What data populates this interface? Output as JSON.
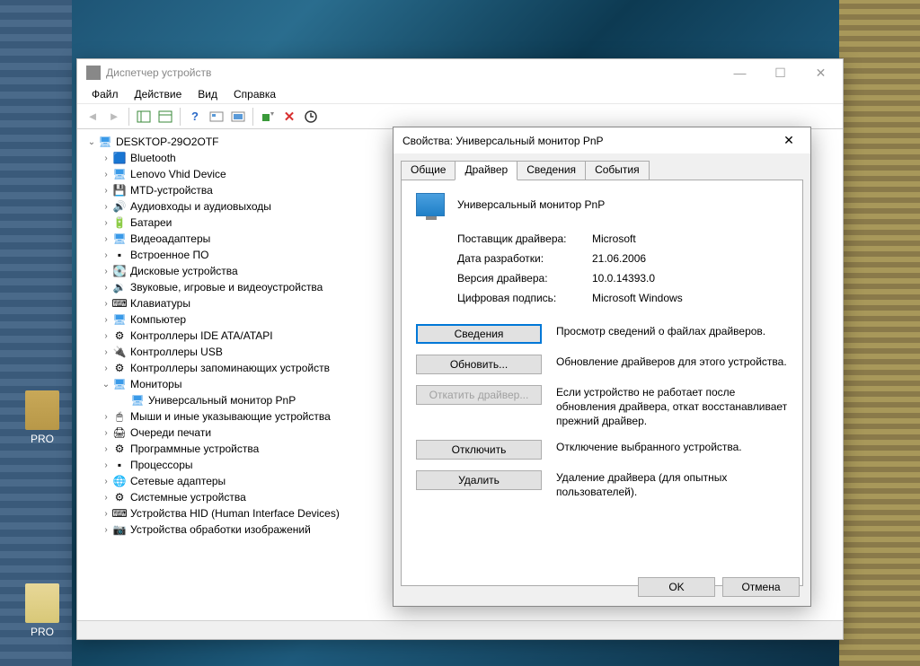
{
  "desktop": {
    "label1": "PRO",
    "label2": "PRO"
  },
  "dm": {
    "title": "Диспетчер устройств",
    "menu": [
      "Файл",
      "Действие",
      "Вид",
      "Справка"
    ],
    "root": "DESKTOP-29O2OTF",
    "nodes": [
      {
        "label": "Bluetooth",
        "icon": "bt"
      },
      {
        "label": "Lenovo Vhid Device",
        "icon": "dev"
      },
      {
        "label": "MTD-устройства",
        "icon": "mtd"
      },
      {
        "label": "Аудиовходы и аудиовыходы",
        "icon": "audio"
      },
      {
        "label": "Батареи",
        "icon": "bat"
      },
      {
        "label": "Видеоадаптеры",
        "icon": "vid"
      },
      {
        "label": "Встроенное ПО",
        "icon": "fw"
      },
      {
        "label": "Дисковые устройства",
        "icon": "disk"
      },
      {
        "label": "Звуковые, игровые и видеоустройства",
        "icon": "snd"
      },
      {
        "label": "Клавиатуры",
        "icon": "kb"
      },
      {
        "label": "Компьютер",
        "icon": "pc"
      },
      {
        "label": "Контроллеры IDE ATA/ATAPI",
        "icon": "ide"
      },
      {
        "label": "Контроллеры USB",
        "icon": "usb"
      },
      {
        "label": "Контроллеры запоминающих устройств",
        "icon": "stor"
      },
      {
        "label": "Мониторы",
        "icon": "mon",
        "expanded": true,
        "children": [
          {
            "label": "Универсальный монитор PnP",
            "icon": "mon"
          }
        ]
      },
      {
        "label": "Мыши и иные указывающие устройства",
        "icon": "mouse"
      },
      {
        "label": "Очереди печати",
        "icon": "print"
      },
      {
        "label": "Программные устройства",
        "icon": "soft"
      },
      {
        "label": "Процессоры",
        "icon": "cpu"
      },
      {
        "label": "Сетевые адаптеры",
        "icon": "net"
      },
      {
        "label": "Системные устройства",
        "icon": "sys"
      },
      {
        "label": "Устройства HID (Human Interface Devices)",
        "icon": "hid"
      },
      {
        "label": "Устройства обработки изображений",
        "icon": "img"
      }
    ]
  },
  "prop": {
    "title": "Свойства: Универсальный монитор PnP",
    "tabs": [
      "Общие",
      "Драйвер",
      "Сведения",
      "События"
    ],
    "device_name": "Универсальный монитор PnP",
    "info": {
      "provider_label": "Поставщик драйвера:",
      "provider": "Microsoft",
      "date_label": "Дата разработки:",
      "date": "21.06.2006",
      "version_label": "Версия драйвера:",
      "version": "10.0.14393.0",
      "signer_label": "Цифровая подпись:",
      "signer": "Microsoft Windows"
    },
    "buttons": {
      "details": {
        "label": "Сведения",
        "desc": "Просмотр сведений о файлах драйверов."
      },
      "update": {
        "label": "Обновить...",
        "desc": "Обновление драйверов для этого устройства."
      },
      "rollback": {
        "label": "Откатить драйвер...",
        "desc": "Если устройство не работает после обновления драйвера, откат восстанавливает прежний драйвер."
      },
      "disable": {
        "label": "Отключить",
        "desc": "Отключение выбранного устройства."
      },
      "uninstall": {
        "label": "Удалить",
        "desc": "Удаление драйвера (для опытных пользователей)."
      }
    },
    "ok": "OK",
    "cancel": "Отмена"
  }
}
